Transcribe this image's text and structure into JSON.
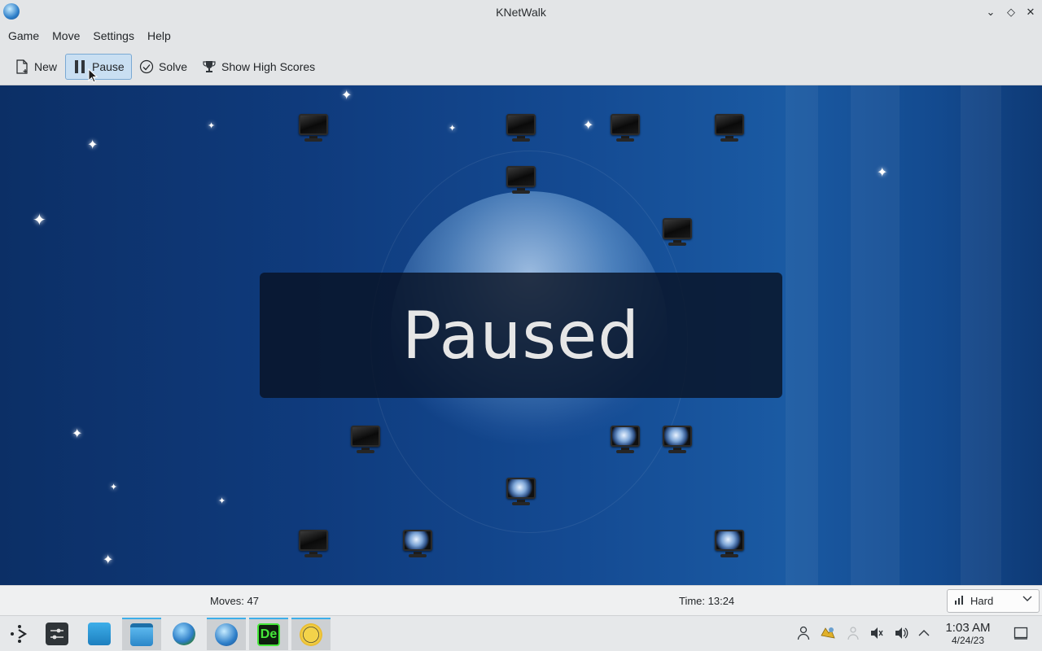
{
  "window": {
    "title": "KNetWalk",
    "controls": {
      "minimize": "⌄",
      "maximize": "◇",
      "close": "✕"
    }
  },
  "menubar": {
    "items": [
      "Game",
      "Move",
      "Settings",
      "Help"
    ]
  },
  "toolbar": {
    "new_label": "New",
    "pause_label": "Pause",
    "solve_label": "Solve",
    "highscores_label": "Show High Scores"
  },
  "game": {
    "overlay_text": "Paused",
    "colors": {
      "background": "#0f3b7d",
      "overlay": "#081224"
    }
  },
  "statusbar": {
    "moves": "Moves: 47",
    "time": "Time: 13:24",
    "difficulty": "Hard"
  },
  "taskbar": {
    "apps": [
      "application-launcher-icon",
      "settings-icon",
      "discover-store-icon",
      "file-manager-icon",
      "web-browser-icon",
      "knetwalk-icon",
      "designer-icon",
      "bee-game-icon"
    ],
    "clock_time": "1:03 AM",
    "clock_date": "4/24/23"
  }
}
